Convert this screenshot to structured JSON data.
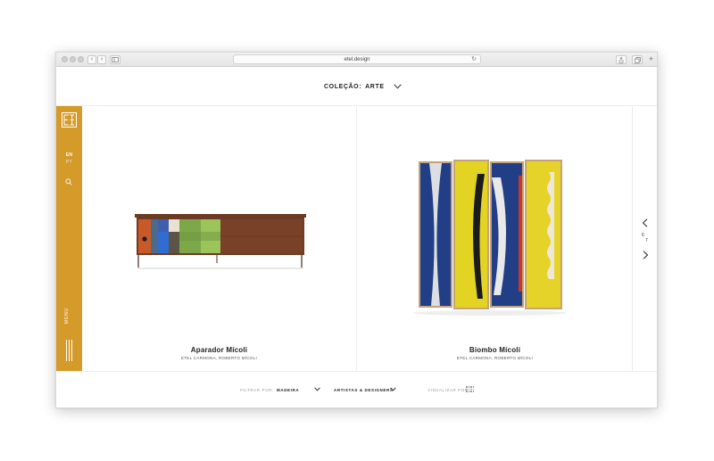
{
  "browser": {
    "address": "etel.design",
    "reload_glyph": "↻",
    "new_tab_glyph": "+",
    "back_glyph": "‹",
    "forward_glyph": "›"
  },
  "header": {
    "collection_label": "COLEÇÃO:",
    "collection_value": "ARTE"
  },
  "sidebar": {
    "brand_color": "#d49a2a",
    "lang_active": "EN",
    "lang_alt": "PT",
    "menu_label": "MENU"
  },
  "products": [
    {
      "name": "Aparador Mícoli",
      "designer": "ETEL CARMONA, ROBERTO MÍCOLI"
    },
    {
      "name": "Biombo Mícoli",
      "designer": "ETEL CARMONA, ROBERTO MÍCOLI"
    }
  ],
  "pager": {
    "current": "6",
    "total": "7"
  },
  "filters": {
    "filter_by_label": "FILTRAR POR:",
    "material": "MADEIRA",
    "artists": "ARTISTAS & DESIGNERS",
    "view_by_label": "VISUALIZAR POR:"
  }
}
